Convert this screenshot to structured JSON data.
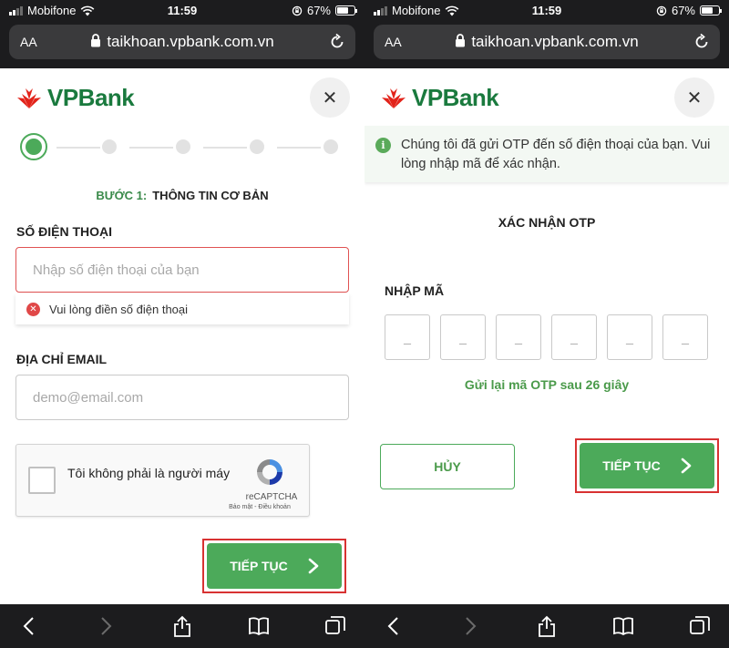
{
  "status": {
    "carrier": "Mobifone",
    "time": "11:59",
    "battery": "67%",
    "battery_fraction": 0.67
  },
  "browser": {
    "aa_label": "AA",
    "url": "taikhoan.vpbank.com.vn"
  },
  "brand": {
    "name": "VPBank",
    "green": "#1a7a3e",
    "red": "#e2231a",
    "accent": "#4caa5a"
  },
  "left": {
    "step": {
      "number": "BƯỚC 1:",
      "title": "THÔNG TIN CƠ BẢN",
      "total_steps": 5,
      "current_step": 1
    },
    "phone": {
      "label": "SỐ ĐIỆN THOẠI",
      "placeholder": "Nhập số điện thoại của bạn",
      "error": "Vui lòng điền số điện thoại"
    },
    "email": {
      "label": "ĐỊA CHỈ EMAIL",
      "placeholder": "demo@email.com"
    },
    "captcha": {
      "text": "Tôi không phải là người máy",
      "brand": "reCAPTCHA",
      "links": "Bảo mật - Điều khoản"
    },
    "continue_label": "TIẾP TỤC"
  },
  "right": {
    "info": "Chúng tôi đã gửi OTP đến số điện thoại của bạn. Vui lòng nhập mã để xác nhận.",
    "title": "XÁC NHẬN OTP",
    "code_label": "NHẬP MÃ",
    "otp_cells": [
      "_",
      "_",
      "_",
      "_",
      "_",
      "_"
    ],
    "resend": "Gửi lại mã OTP sau 26 giây",
    "cancel_label": "HỦY",
    "continue_label": "TIẾP TỤC"
  },
  "icons": {
    "lock": "lock-icon",
    "reload": "reload-icon",
    "close": "close-icon",
    "back": "chevron-left-icon",
    "forward": "chevron-right-icon",
    "share": "share-icon",
    "bookmarks": "book-icon",
    "tabs": "tabs-icon",
    "info": "info-icon",
    "error": "error-icon"
  }
}
